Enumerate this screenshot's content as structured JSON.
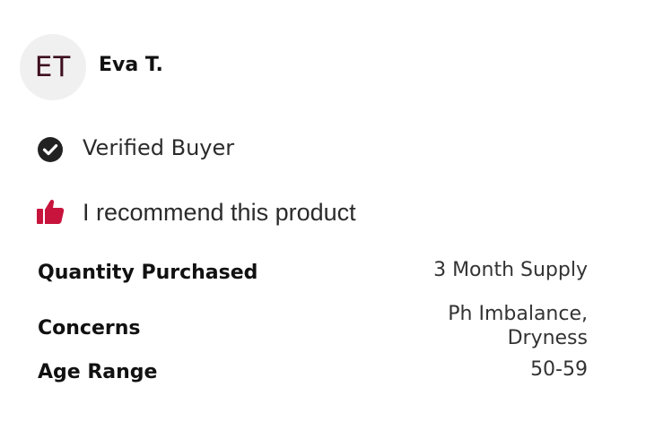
{
  "reviewer": {
    "initials": "ET",
    "name": "Eva T."
  },
  "badges": {
    "verified_icon": "check-circle-icon",
    "verified_label": "Verified Buyer",
    "recommend_icon": "thumbs-up-icon",
    "recommend_label": "I recommend this product"
  },
  "attributes": {
    "quantity_label": "Quantity Purchased",
    "quantity_value": "3 Month Supply",
    "concerns_label": "Concerns",
    "concerns_value_line1": "Ph Imbalance,",
    "concerns_value_line2": "Dryness",
    "age_label": "Age Range",
    "age_value": "50-59"
  },
  "colors": {
    "avatar_bg": "#f1f0f0",
    "initials": "#3d0f1f",
    "thumb": "#c8143c",
    "check": "#222222"
  }
}
